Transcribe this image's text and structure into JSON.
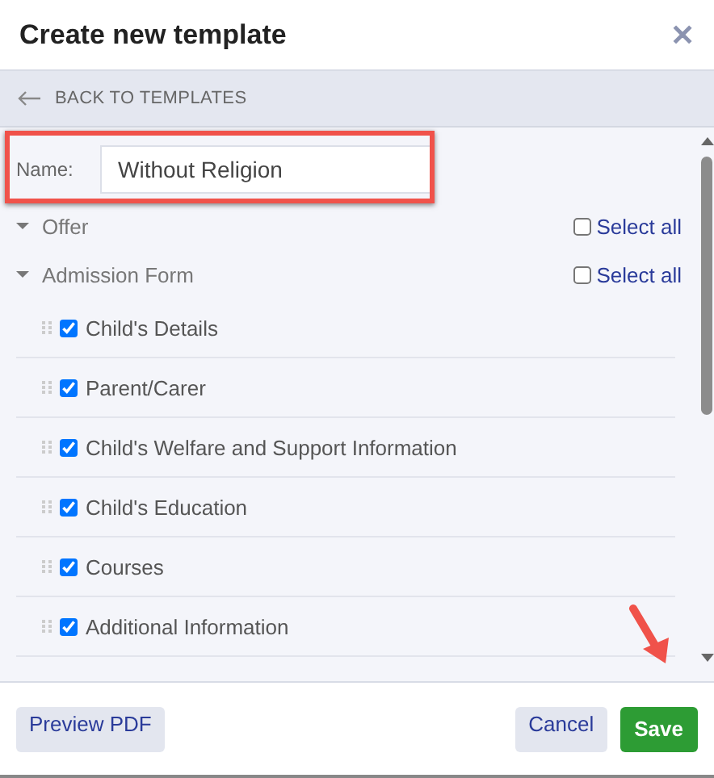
{
  "window": {
    "title": "Create new template",
    "close": "✕"
  },
  "back_link": "BACK TO TEMPLATES",
  "name_field": {
    "label": "Name:",
    "value": "Without Religion"
  },
  "sections": [
    {
      "title": "Offer",
      "expanded": true,
      "select_all": {
        "label": "Select all",
        "checked": false
      }
    },
    {
      "title": "Admission Form",
      "expanded": true,
      "select_all": {
        "label": "Select all",
        "checked": false
      },
      "items": [
        {
          "label": "Child's Details",
          "checked": true
        },
        {
          "label": "Parent/Carer",
          "checked": true
        },
        {
          "label": "Child's Welfare and Support Information",
          "checked": true
        },
        {
          "label": "Child's Education",
          "checked": true
        },
        {
          "label": "Courses",
          "checked": true
        },
        {
          "label": "Additional Information",
          "checked": true
        }
      ]
    }
  ],
  "footer": {
    "preview": "Preview PDF",
    "cancel": "Cancel",
    "save": "Save"
  }
}
